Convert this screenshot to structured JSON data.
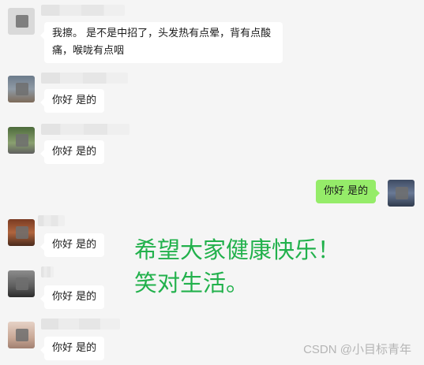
{
  "messages": [
    {
      "text": "我擦。 是不是中招了，头发热有点晕，背有点酸痛，喉咙有点咽"
    },
    {
      "text": "你好 是的"
    },
    {
      "text": "你好 是的"
    },
    {
      "text": "你好 是的"
    },
    {
      "text": "你好 是的"
    },
    {
      "text": "你好 是的"
    },
    {
      "text": "你好 是的"
    }
  ],
  "overlay": {
    "line1": "希望大家健康快乐！",
    "line2": "笑对生活。",
    "color": "#22b14c"
  },
  "watermark": "CSDN @小目标青年",
  "colors": {
    "background": "#f5f5f5",
    "incoming_bubble": "#ffffff",
    "outgoing_bubble": "#95ec69"
  }
}
